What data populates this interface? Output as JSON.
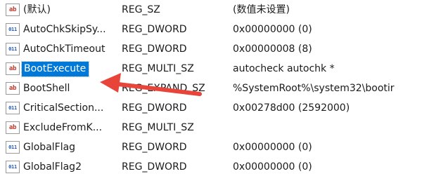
{
  "registry_list": {
    "rows": [
      {
        "name": "(默认)",
        "type": "REG_SZ",
        "data": "(数值未设置)",
        "icon": "string-value-icon",
        "icon_text": "ab",
        "selected": false
      },
      {
        "name": "AutoChkSkipSy...",
        "type": "REG_DWORD",
        "data": "0x00000000 (0)",
        "icon": "binary-value-icon",
        "icon_text": "011",
        "selected": false
      },
      {
        "name": "AutoChkTimeout",
        "type": "REG_DWORD",
        "data": "0x00000008 (8)",
        "icon": "binary-value-icon",
        "icon_text": "011",
        "selected": false
      },
      {
        "name": "BootExecute",
        "type": "REG_MULTI_SZ",
        "data": "autocheck autochk *",
        "icon": "string-value-icon",
        "icon_text": "ab",
        "selected": true
      },
      {
        "name": "BootShell",
        "type": "REG_EXPAND_SZ",
        "data": "%SystemRoot%\\system32\\bootir",
        "icon": "string-value-icon",
        "icon_text": "ab",
        "selected": false
      },
      {
        "name": "CriticalSection...",
        "type": "REG_DWORD",
        "data": "0x00278d00 (2592000)",
        "icon": "binary-value-icon",
        "icon_text": "011",
        "selected": false
      },
      {
        "name": "ExcludeFromK...",
        "type": "REG_MULTI_SZ",
        "data": "",
        "icon": "string-value-icon",
        "icon_text": "ab",
        "selected": false
      },
      {
        "name": "GlobalFlag",
        "type": "REG_DWORD",
        "data": "0x00000000 (0)",
        "icon": "binary-value-icon",
        "icon_text": "011",
        "selected": false
      },
      {
        "name": "GlobalFlag2",
        "type": "REG_DWORD",
        "data": "0x00000000 (0)",
        "icon": "binary-value-icon",
        "icon_text": "011",
        "selected": false
      }
    ]
  },
  "colors": {
    "selection": "#0078d7",
    "annotation_arrow": "#e8443a",
    "string_icon": "#c0392b",
    "binary_icon": "#1f56b8"
  }
}
